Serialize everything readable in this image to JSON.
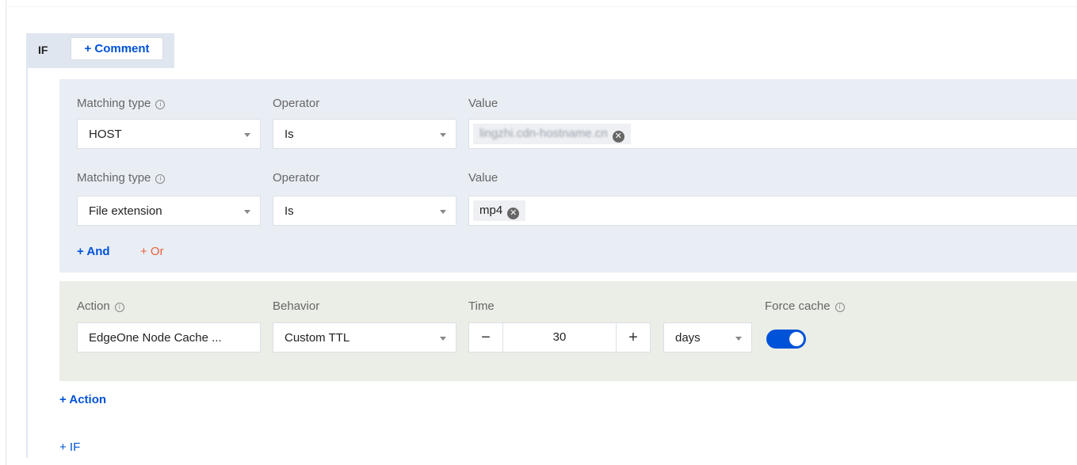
{
  "if_block": {
    "label": "IF",
    "comment_button": "+ Comment"
  },
  "conditions": [
    {
      "matching_type_label": "Matching type",
      "operator_label": "Operator",
      "value_label": "Value",
      "matching_type": "HOST",
      "operator": "Is",
      "value_tag": "lingzhi.cdn-hostname.cn",
      "value_blurred": true
    },
    {
      "matching_type_label": "Matching type",
      "operator_label": "Operator",
      "value_label": "Value",
      "matching_type": "File extension",
      "operator": "Is",
      "value_tag": "mp4",
      "value_blurred": false
    }
  ],
  "add_and": "+ And",
  "add_or": "+ Or",
  "action": {
    "action_label": "Action",
    "behavior_label": "Behavior",
    "time_label": "Time",
    "force_cache_label": "Force cache",
    "action_value": "EdgeOne Node Cache ...",
    "behavior_value": "Custom TTL",
    "time_value": "30",
    "time_unit": "days",
    "decrement_symbol": "−",
    "increment_symbol": "+",
    "force_cache_on": true
  },
  "add_action": "+ Action",
  "add_if": "+ IF",
  "colors": {
    "accent": "#0052d9",
    "or_link": "#e8603c",
    "condition_bg": "#e9eef5",
    "action_bg": "#ebeee6"
  }
}
